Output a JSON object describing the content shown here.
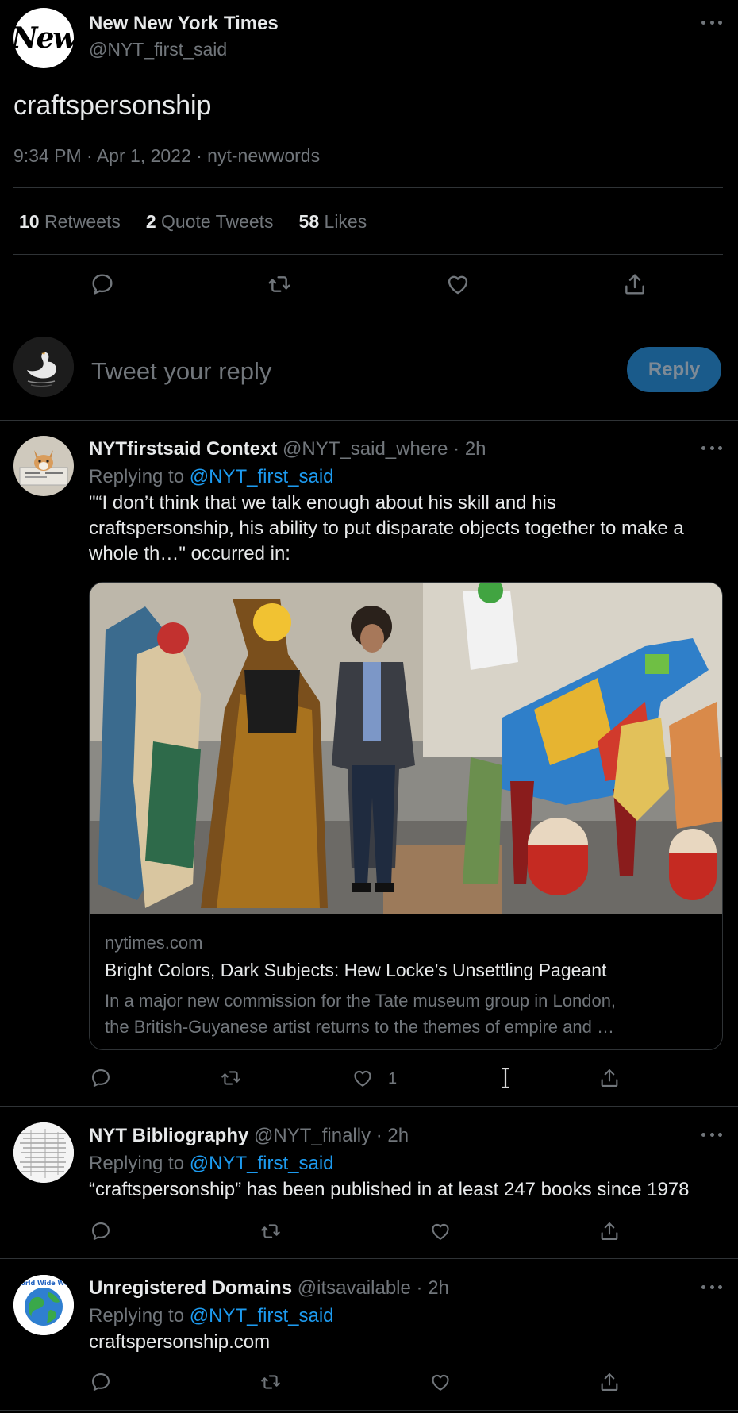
{
  "main_tweet": {
    "avatar_text": "New",
    "name": "New New York Times",
    "handle": "@NYT_first_said",
    "text": "craftspersonship",
    "meta": "9:34 PM · Apr 1, 2022 · nyt-newwords",
    "stats": {
      "retweets_count": "10",
      "retweets_label": "Retweets",
      "quotes_count": "2",
      "quotes_label": "Quote Tweets",
      "likes_count": "58",
      "likes_label": "Likes"
    }
  },
  "reply_box": {
    "placeholder": "Tweet your reply",
    "button": "Reply"
  },
  "replies": [
    {
      "name": "NYTfirstsaid Context",
      "handle": "@NYT_said_where",
      "time": "· 2h",
      "replying_prefix": "Replying to",
      "replying_to": "@NYT_first_said",
      "text_line1": "\"“I don’t think that we talk enough about his skill and his",
      "text_line2": "craftspersonship, his ability to put disparate objects together to make a",
      "text_line3": "whole th…\" occurred in:",
      "card": {
        "domain": "nytimes.com",
        "title": "Bright Colors, Dark Subjects: Hew Locke’s Unsettling Pageant",
        "desc_line1": "In a major new commission for the Tate museum group in London,",
        "desc_line2": "the British-Guyanese artist returns to the themes of empire and …"
      },
      "like_count": "1"
    },
    {
      "name": "NYT Bibliography",
      "handle": "@NYT_finally",
      "time": "· 2h",
      "replying_prefix": "Replying to",
      "replying_to": "@NYT_first_said",
      "text": "“craftspersonship” has been published in at least 247 books since 1978"
    },
    {
      "name": "Unregistered Domains",
      "handle": "@itsavailable",
      "time": "· 2h",
      "replying_prefix": "Replying to",
      "replying_to": "@NYT_first_said",
      "text": "craftspersonship.com",
      "avatar_text": "World Wide Web"
    }
  ],
  "colors": {
    "background": "#000000",
    "text": "#e7e9ea",
    "muted": "#71767b",
    "link": "#1d9bf0",
    "divider": "#2f3336",
    "reply_button": "#1a5b8b"
  },
  "icons": [
    "reply-icon",
    "retweet-icon",
    "like-icon",
    "share-icon",
    "more-icon"
  ]
}
